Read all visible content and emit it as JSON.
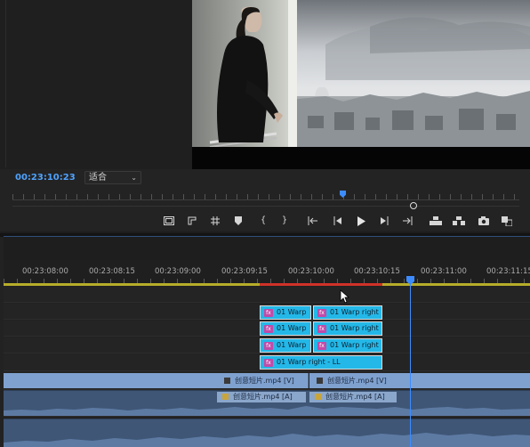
{
  "monitor": {
    "timecode": "00:23:10:23",
    "fit_select": {
      "selected": "适合"
    },
    "transport_icons": [
      "safe-margins-icon",
      "insert-crop-icon",
      "grid-icon",
      "add-marker-icon",
      "mark-in-icon",
      "mark-out-icon",
      "go-to-in-icon",
      "step-back-icon",
      "play-icon",
      "step-forward-icon",
      "go-to-out-icon",
      "lift-icon",
      "extract-icon",
      "export-frame-icon",
      "compare-view-icon"
    ]
  },
  "timeline": {
    "ruler_labels": [
      "00:23:08:00",
      "00:23:08:15",
      "00:23:09:00",
      "00:23:09:15",
      "00:23:10:00",
      "00:23:10:15",
      "00:23:11:00",
      "00:23:11:15"
    ],
    "colors": {
      "playhead": "#3d8cff",
      "work_area": "#b6ad2a",
      "render_needed": "#d03228",
      "adjustment_clip": "#23b8e8",
      "video_clip": "#7fa1cf"
    },
    "fx_clips": {
      "row1": [
        "01 Warp",
        "01 Warp right"
      ],
      "row2": [
        "01 Warp",
        "01 Warp right"
      ],
      "row3": [
        "01 Warp",
        "01 Warp right"
      ],
      "row4": [
        "01 Warp right - LL"
      ]
    },
    "fx_badge": "fx",
    "video_clips": [
      "创意短片.mp4 [V]",
      "创意短片.mp4 [V]"
    ],
    "audio_clips": [
      "创意短片.mp4 [A]",
      "创意短片.mp4 [A]"
    ]
  }
}
